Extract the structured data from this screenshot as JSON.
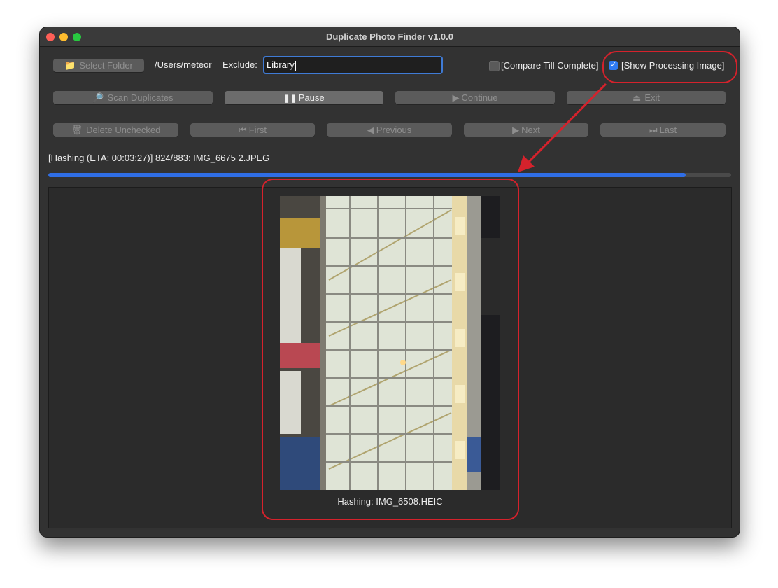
{
  "window": {
    "title": "Duplicate Photo Finder v1.0.0"
  },
  "toolbar": {
    "select_folder": "Select Folder",
    "path": "/Users/meteor",
    "exclude_label": "Exclude:",
    "exclude_value": "Library",
    "compare_till_complete": "[Compare Till Complete]",
    "compare_checked": false,
    "show_processing_image": "[Show Processing Image]",
    "show_checked": true
  },
  "actions": {
    "scan_duplicates": "Scan Duplicates",
    "pause": "Pause",
    "continue": "Continue",
    "exit": "Exit"
  },
  "navigation": {
    "delete_unchecked": "Delete Unchecked",
    "first": "First",
    "previous": "Previous",
    "next": "Next",
    "last": "Last"
  },
  "status": {
    "text": "[Hashing (ETA: 00:03:27)] 824/883: IMG_6675 2.JPEG",
    "processed": 824,
    "total": 883
  },
  "preview": {
    "caption": "Hashing: IMG_6508.HEIC"
  },
  "icons": {
    "folder": "folder-icon",
    "magnifier": "magnifier-icon",
    "pause": "pause-icon",
    "play": "play-icon",
    "exit": "exit-icon",
    "trash": "trash-icon",
    "first": "skip-first-icon",
    "previous": "previous-icon",
    "next": "next-icon",
    "last": "skip-last-icon"
  },
  "colors": {
    "accent": "#2f6ee6",
    "annotation": "#d5222c"
  }
}
